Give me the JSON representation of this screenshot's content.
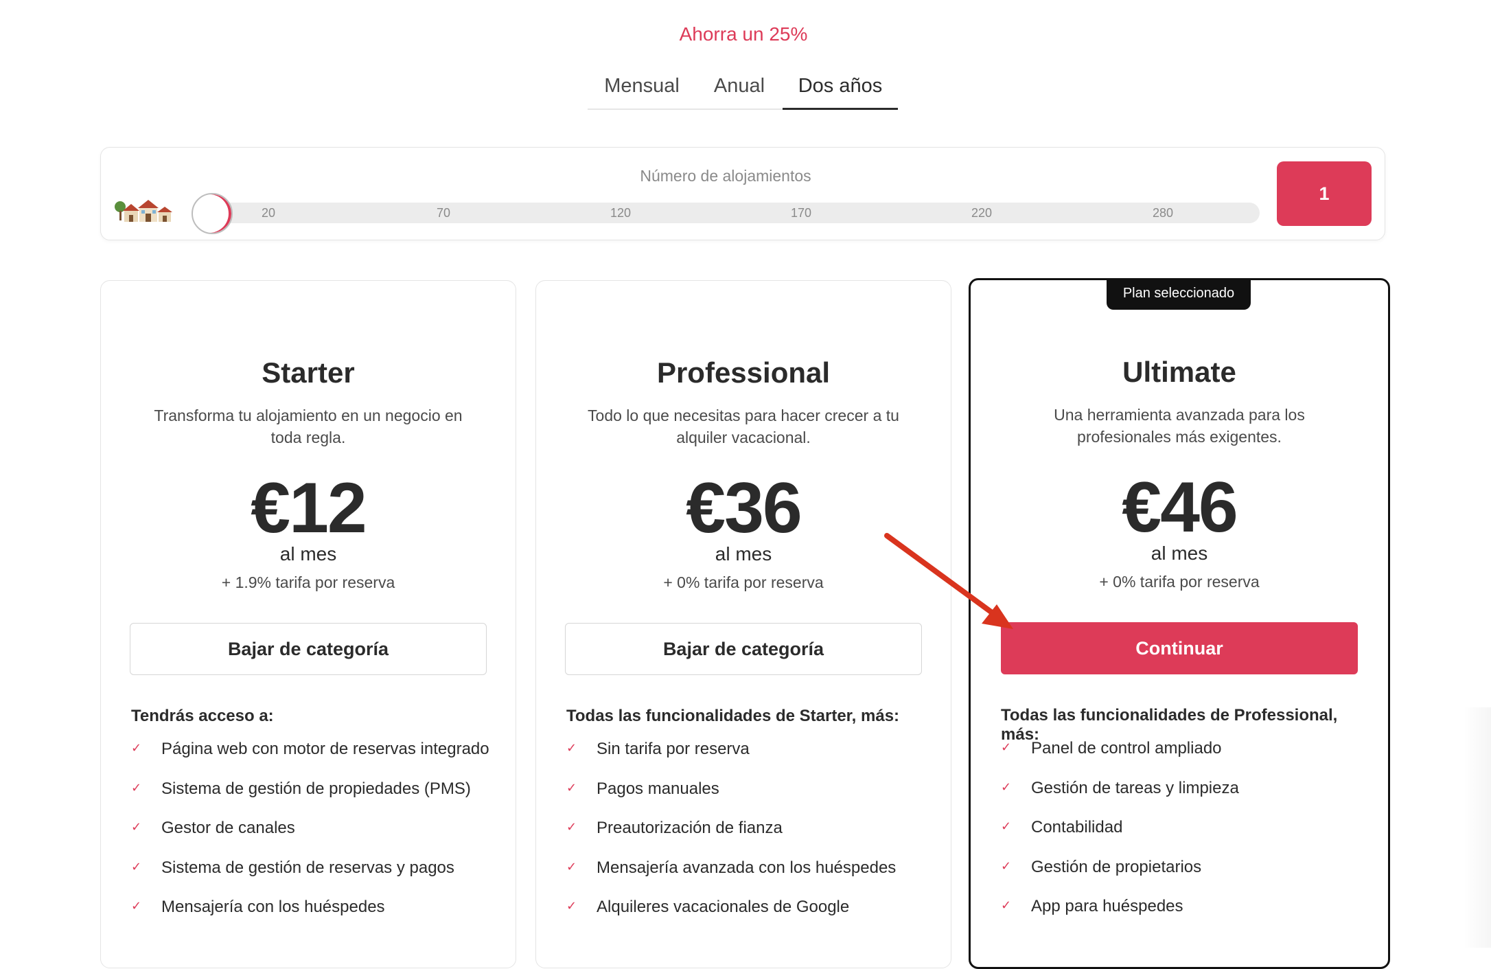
{
  "billing": {
    "savings_label": "Ahorra un 25%",
    "tabs": [
      {
        "label": "Mensual",
        "active": false
      },
      {
        "label": "Anual",
        "active": false
      },
      {
        "label": "Dos años",
        "active": true
      }
    ]
  },
  "slider": {
    "title": "Número de alojamientos",
    "houses_icon": "houses-icon",
    "ticks": [
      "20",
      "70",
      "120",
      "170",
      "220",
      "280"
    ],
    "count": "1"
  },
  "plans": [
    {
      "name": "Starter",
      "description": "Transforma tu alojamiento en un negocio en toda regla.",
      "price": "€12",
      "per": "al mes",
      "fee": "+ 1.9% tarifa por reserva",
      "button": "Bajar de categoría",
      "features_heading": "Tendrás acceso a:",
      "features": [
        "Página web con motor de reservas integrado",
        "Sistema de gestión de propiedades (PMS)",
        "Gestor de canales",
        "Sistema de gestión de reservas y pagos",
        "Mensajería con los huéspedes"
      ]
    },
    {
      "name": "Professional",
      "description": "Todo lo que necesitas para hacer crecer a tu alquiler vacacional.",
      "price": "€36",
      "per": "al mes",
      "fee": "+ 0% tarifa por reserva",
      "button": "Bajar de categoría",
      "features_heading": "Todas las funcionalidades de Starter, más:",
      "features": [
        "Sin tarifa por reserva",
        "Pagos manuales",
        "Preautorización de fianza",
        "Mensajería avanzada con los huéspedes",
        "Alquileres vacacionales de Google"
      ]
    },
    {
      "name": "Ultimate",
      "badge": "Plan seleccionado",
      "description": "Una herramienta avanzada para los profesionales más exigentes.",
      "price": "€46",
      "per": "al mes",
      "fee": "+ 0% tarifa por reserva",
      "button": "Continuar",
      "features_heading": "Todas las funcionalidades de Professional, más:",
      "features": [
        "Panel de control ampliado",
        "Gestión de tareas y limpieza",
        "Contabilidad",
        "Gestión de propietarios",
        "App para huéspedes"
      ]
    }
  ],
  "colors": {
    "accent": "#dd3b58",
    "annotation_arrow": "#d9341e"
  }
}
